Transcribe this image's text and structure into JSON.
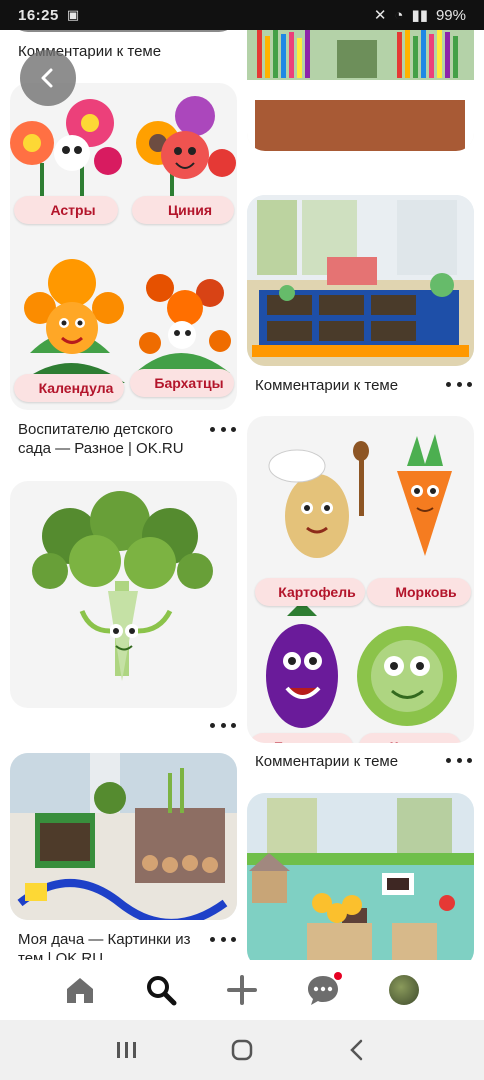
{
  "status_bar": {
    "time": "16:25",
    "battery": "99%"
  },
  "pins": {
    "top_left_caption": "Комментарии к теме",
    "flowers": {
      "labels": [
        "Астры",
        "Циния",
        "Календула",
        "Бархатцы"
      ],
      "caption": "Воспитателю детского сада — Разное | OK.RU"
    },
    "window_garden_caption": "Комментарии к теме",
    "vegetables": {
      "labels": [
        "Картофель",
        "Морковь",
        "Баклажан",
        "Капуста"
      ],
      "caption": "Комментарии к теме"
    },
    "dacha_caption": "Моя дача — Картинки из тем | OK.RU"
  },
  "bottom_nav": [
    "home-icon",
    "search-icon",
    "plus-icon",
    "chat-icon",
    "profile-avatar"
  ],
  "colors": {
    "accent": "#e60023",
    "label_bg": "#fbe2e2",
    "label_text": "#b3152b"
  }
}
